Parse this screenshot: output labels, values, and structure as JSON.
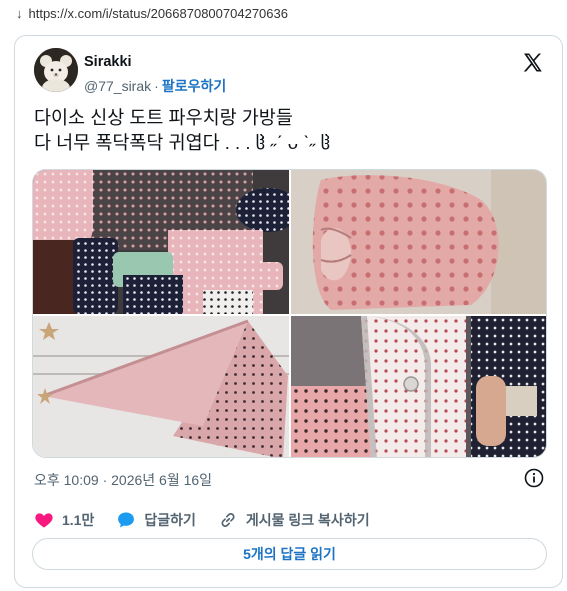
{
  "browser": {
    "download_arrow": "↓",
    "url": "https://x.com/i/status/2066870800704270636"
  },
  "tweet": {
    "author_name": "Sirakki",
    "author_handle": "@77_sirak",
    "separator": "·",
    "follow_label": "팔로우하기",
    "text_line1": "다이소 신상 도트 파우치랑 가방들",
    "text_line2": "다 너무 폭닥폭닥 귀엽다 . . . ჱ̒ ˶ˊ ᴗ ˋ˶ ჱ",
    "timestamp": "오후 10:09 · 2026년 6월 16일",
    "like_count": "1.1만",
    "reply_label": "답글하기",
    "copy_link_label": "게시물 링크 복사하기",
    "read_replies_label": "5개의 답글 읽기"
  },
  "colors": {
    "accent": "#1d74c4",
    "like": "#f91880",
    "reply": "#1d9bf0",
    "muted": "#536471",
    "border": "#cfd9de"
  },
  "icons": {
    "like": "heart-icon",
    "reply": "speech-bubble-icon",
    "copy_link": "link-icon",
    "info": "info-icon",
    "logo": "x-logo-icon"
  }
}
